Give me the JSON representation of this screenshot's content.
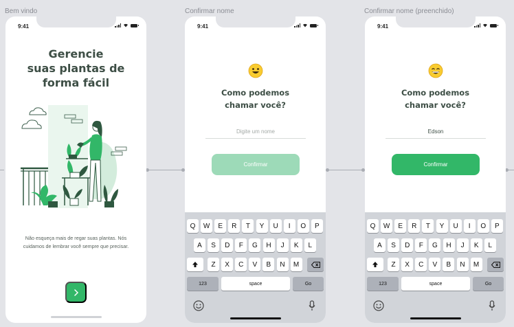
{
  "frames": [
    {
      "label": "Bem vindo"
    },
    {
      "label": "Confirmar nome"
    },
    {
      "label": "Confirmar nome (preenchido)"
    }
  ],
  "status": {
    "time": "9:41"
  },
  "welcome": {
    "title": "Gerencie\nsuas plantas de\nforma fácil",
    "description": "Não esqueça mais de regar suas plantas. Nós cuidamos de lembrar você sempre que precisar.",
    "next_icon": "chevron-right-icon"
  },
  "name_empty": {
    "emoji": "smiling-face-icon",
    "title": "Como podemos\nchamar você?",
    "input_placeholder": "Digite um nome",
    "input_value": "",
    "button_label": "Confirmar"
  },
  "name_filled": {
    "emoji": "grinning-face-icon",
    "title": "Como podemos\nchamar você?",
    "input_placeholder": "Digite um nome",
    "input_value": "Edson",
    "button_label": "Confirmar"
  },
  "keyboard": {
    "row1": [
      "Q",
      "W",
      "E",
      "R",
      "T",
      "Y",
      "U",
      "I",
      "O",
      "P"
    ],
    "row2": [
      "A",
      "S",
      "D",
      "F",
      "G",
      "H",
      "J",
      "K",
      "L"
    ],
    "row3": [
      "Z",
      "X",
      "C",
      "V",
      "B",
      "N",
      "M"
    ],
    "numbers_label": "123",
    "space_label": "space",
    "go_label": "Go"
  },
  "colors": {
    "accent": "#32b768",
    "accent_disabled": "#9ddab8",
    "title_text": "#3d4e45",
    "background": "#e3e4e8"
  }
}
